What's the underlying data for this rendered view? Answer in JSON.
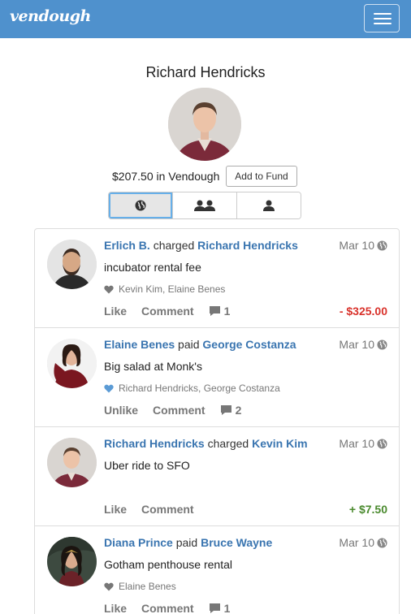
{
  "nav": {
    "brand": "vendough"
  },
  "profile": {
    "name": "Richard Hendricks",
    "balance": "$207.50 in Vendough",
    "add_fund_label": "Add to Fund"
  },
  "filters": [
    {
      "icon": "globe-icon",
      "active": true
    },
    {
      "icon": "friends-icon",
      "active": false
    },
    {
      "icon": "user-icon",
      "active": false
    }
  ],
  "feed": [
    {
      "actor": "Erlich B.",
      "verb": "charged",
      "target": "Richard Hendricks",
      "date": "Mar 10",
      "note": "incubator rental fee",
      "likes": "Kevin Kim, Elaine Benes",
      "liked": false,
      "like_label": "Like",
      "comment_label": "Comment",
      "comment_count": "1",
      "amount": "- $325.00",
      "amount_color": "#d9322b"
    },
    {
      "actor": "Elaine Benes",
      "verb": "paid",
      "target": "George Costanza",
      "date": "Mar 10",
      "note": "Big salad at Monk's",
      "likes": "Richard Hendricks, George Costanza",
      "liked": true,
      "like_label": "Unlike",
      "comment_label": "Comment",
      "comment_count": "2",
      "amount": ""
    },
    {
      "actor": "Richard Hendricks",
      "verb": "charged",
      "target": "Kevin Kim",
      "date": "Mar 10",
      "note": "Uber ride to SFO",
      "likes": "",
      "liked": false,
      "like_label": "Like",
      "comment_label": "Comment",
      "comment_count": "",
      "amount": "+ $7.50",
      "amount_color": "#4a8a2e"
    },
    {
      "actor": "Diana Prince",
      "verb": "paid",
      "target": "Bruce Wayne",
      "date": "Mar 10",
      "note": "Gotham penthouse rental",
      "likes": "Elaine Benes",
      "liked": false,
      "like_label": "Like",
      "comment_label": "Comment",
      "comment_count": "1",
      "amount": ""
    }
  ],
  "colors": {
    "navbar": "#4f91cd",
    "link": "#3a75b0",
    "negative": "#d9322b",
    "positive": "#4a8a2e",
    "liked_heart": "#5b9bd5"
  }
}
